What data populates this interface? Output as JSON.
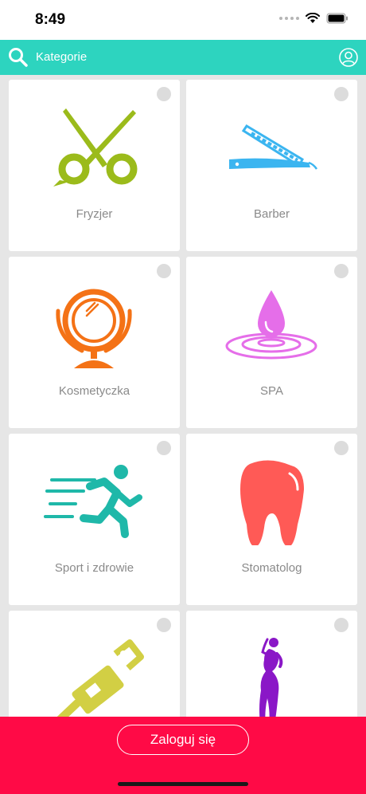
{
  "status_bar": {
    "time": "8:49"
  },
  "nav": {
    "title": "Kategorie"
  },
  "categories": [
    {
      "label": "Fryzjer",
      "icon": "scissors-icon",
      "color": "#9bbb1b"
    },
    {
      "label": "Barber",
      "icon": "razor-icon",
      "color": "#3bb5f0"
    },
    {
      "label": "Kosmetyczka",
      "icon": "mirror-icon",
      "color": "#f47216"
    },
    {
      "label": "SPA",
      "icon": "water-drop-icon",
      "color": "#e56ee9"
    },
    {
      "label": "Sport i zdrowie",
      "icon": "runner-icon",
      "color": "#1fb8a9"
    },
    {
      "label": "Stomatolog",
      "icon": "tooth-icon",
      "color": "#ff5a56"
    },
    {
      "label": "",
      "icon": "tattoo-machine-icon",
      "color": "#d2cf44"
    },
    {
      "label": "",
      "icon": "woman-figure-icon",
      "color": "#8a17c7"
    }
  ],
  "footer": {
    "login_label": "Zaloguj się"
  }
}
